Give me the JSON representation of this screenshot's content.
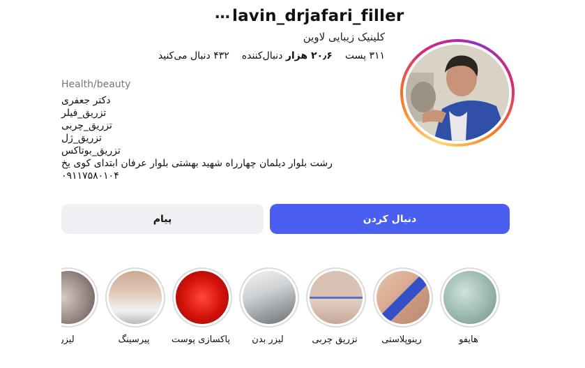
{
  "profile": {
    "username": "lavin_drjafari_filler",
    "more_icon": "…",
    "full_name": "کلینیک زیبایی لاوین",
    "stats": {
      "posts": "۳۱۱ پست",
      "followers_num": "۲۰٫۶ هزار",
      "followers_label": "دنبال‌کننده",
      "following": "۴۳۲ دنبال می‌کنید"
    },
    "category": "Health/beauty",
    "bio_lines": [
      "دکتر جعفری",
      "تزریق_فیلر",
      "تزریق_چربی",
      "تزریق_ژل",
      "تزریق_بوتاکس",
      "رشت بلوار دیلمان چهارراه شهید بهشتی بلوار عرفان ابتدای کوی یخ",
      "۰۹۱۱۷۵۸۰۱۰۴"
    ]
  },
  "actions": {
    "follow_label": "دنبال کردن",
    "message_label": "پیام"
  },
  "highlights": [
    {
      "label": "هایفو"
    },
    {
      "label": "رینوپلاستی"
    },
    {
      "label": "تزریق چربی"
    },
    {
      "label": "لیزر بدن"
    },
    {
      "label": "پاکسازی پوست"
    },
    {
      "label": "پیرسینگ"
    },
    {
      "label": "لیزر"
    }
  ],
  "colors": {
    "follow_button": "#4a5ef0",
    "message_button": "#eff0f3",
    "story_ring": "gradient-orange-pink-purple"
  }
}
